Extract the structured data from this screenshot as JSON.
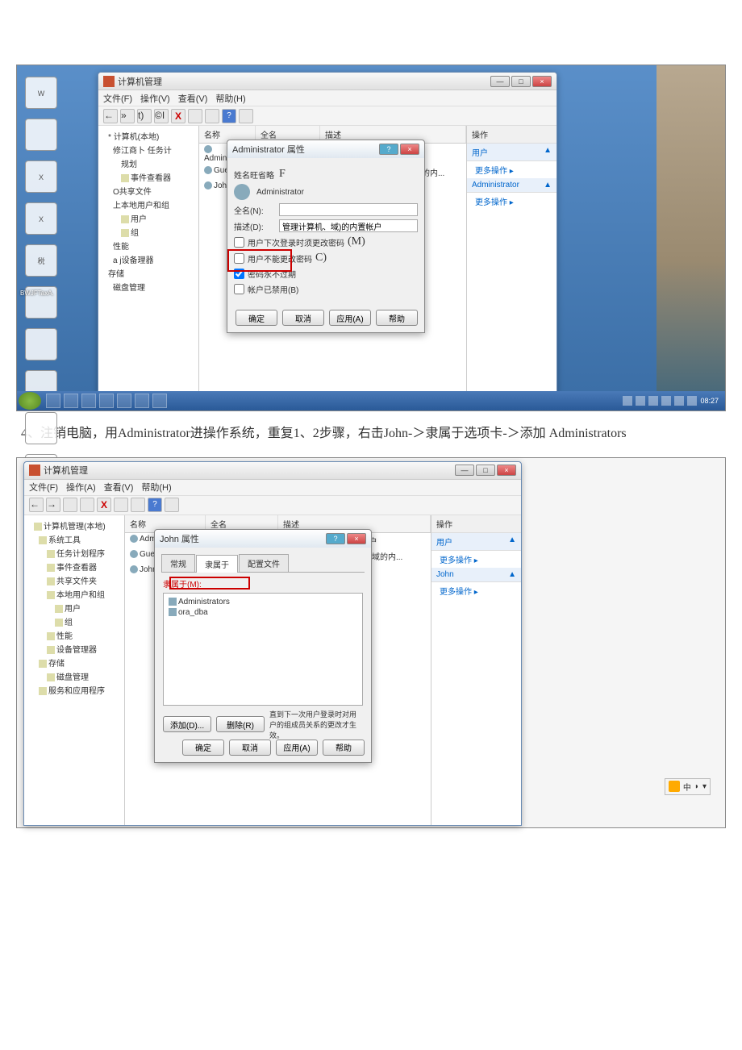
{
  "ss1": {
    "window": {
      "title": "计算机管理",
      "menu": [
        "文件(F)",
        "操作(V)",
        "查看(V)",
        "帮助(H)"
      ],
      "tree": {
        "root": "计算机(本地)",
        "items": [
          "修江商卜 任务计",
          "规划",
          "事件查看器",
          "共享文件",
          "上本地用户和组",
          "用户",
          "组",
          "性能",
          "设备理器",
          "存储",
          "磁盘管理"
        ],
        "icon_asterisk": "*",
        "icon_o": "O",
        "icon_aj": "a j"
      },
      "list": {
        "headers": [
          "名称",
          "全名",
          "描述"
        ],
        "rows": [
          {
            "name": "Administrat...",
            "full": "",
            "desc": "管理计算机(域)的内置帐户"
          },
          {
            "name": "Guest",
            "full": "",
            "desc": "供来宾访问计算机或访问域的内..."
          },
          {
            "name": "John",
            "full": "",
            "desc": ""
          }
        ]
      },
      "actions": {
        "header": "操作",
        "group1": {
          "title": "用户",
          "items": [
            "更多操作"
          ]
        },
        "group2": {
          "title": "Administrator",
          "items": [
            "更多操作"
          ]
        }
      }
    },
    "dialog": {
      "title": "Administrator 属性",
      "username_label": "姓名旺省略",
      "annotation_F": "F",
      "user_value": "Administrator",
      "fullname_label": "全名(N):",
      "desc_label": "描述(D):",
      "desc_value": "管理计算机、域)的内置帐户",
      "chk1": "用户下次登录时须更改密码",
      "annotation_M": "(M)",
      "chk2": "用户不能更改密码",
      "annotation_C": "C)",
      "chk3": "密码永不过期",
      "chk4": "帐户已禁用(B)",
      "buttons": [
        "确定",
        "取消",
        "应用(A)",
        "帮助"
      ]
    },
    "taskbar": {
      "clock": "08:27"
    }
  },
  "caption": "4、注销电脑，用Administrator进操作系统，重复1、2步骤，右击John-＞隶属于选项卡-＞添加 Administrators",
  "ss2": {
    "window": {
      "title": "计算机管理",
      "menu": [
        "文件(F)",
        "操作(A)",
        "查看(V)",
        "帮助(H)"
      ],
      "tree": [
        {
          "lvl": 0,
          "label": "计算机管理(本地)"
        },
        {
          "lvl": 1,
          "label": "系统工具"
        },
        {
          "lvl": 2,
          "label": "任务计划程序"
        },
        {
          "lvl": 2,
          "label": "事件查看器"
        },
        {
          "lvl": 2,
          "label": "共享文件夹"
        },
        {
          "lvl": 2,
          "label": "本地用户和组"
        },
        {
          "lvl": 3,
          "label": "用户"
        },
        {
          "lvl": 3,
          "label": "组"
        },
        {
          "lvl": 2,
          "label": "性能"
        },
        {
          "lvl": 2,
          "label": "设备管理器"
        },
        {
          "lvl": 1,
          "label": "存储"
        },
        {
          "lvl": 2,
          "label": "磁盘管理"
        },
        {
          "lvl": 1,
          "label": "服务和应用程序"
        }
      ],
      "list": {
        "headers": [
          "名称",
          "全名",
          "描述"
        ],
        "rows": [
          {
            "name": "Administrator",
            "full": "",
            "desc": "管理计算机(域)的内置帐户"
          },
          {
            "name": "Guest",
            "full": "",
            "desc": "供来宾访问计算机或访问域的内..."
          },
          {
            "name": "John",
            "full": "",
            "desc": ""
          }
        ]
      },
      "actions": {
        "header": "操作",
        "group1": {
          "title": "用户",
          "items": [
            "更多操作"
          ]
        },
        "group2": {
          "title": "John",
          "items": [
            "更多操作"
          ]
        }
      }
    },
    "dialog": {
      "title": "John 属性",
      "tabs": [
        "常规",
        "隶属于",
        "配置文件"
      ],
      "group_label": "隶属于(M):",
      "members": [
        "Administrators",
        "ora_dba"
      ],
      "hint": "直到下一次用户登录时对用户的组成员关系的更改才生效。",
      "add_btn": "添加(D)...",
      "remove_btn": "删除(R)",
      "buttons": [
        "确定",
        "取消",
        "应用(A)",
        "帮助"
      ]
    },
    "ime": "中"
  }
}
